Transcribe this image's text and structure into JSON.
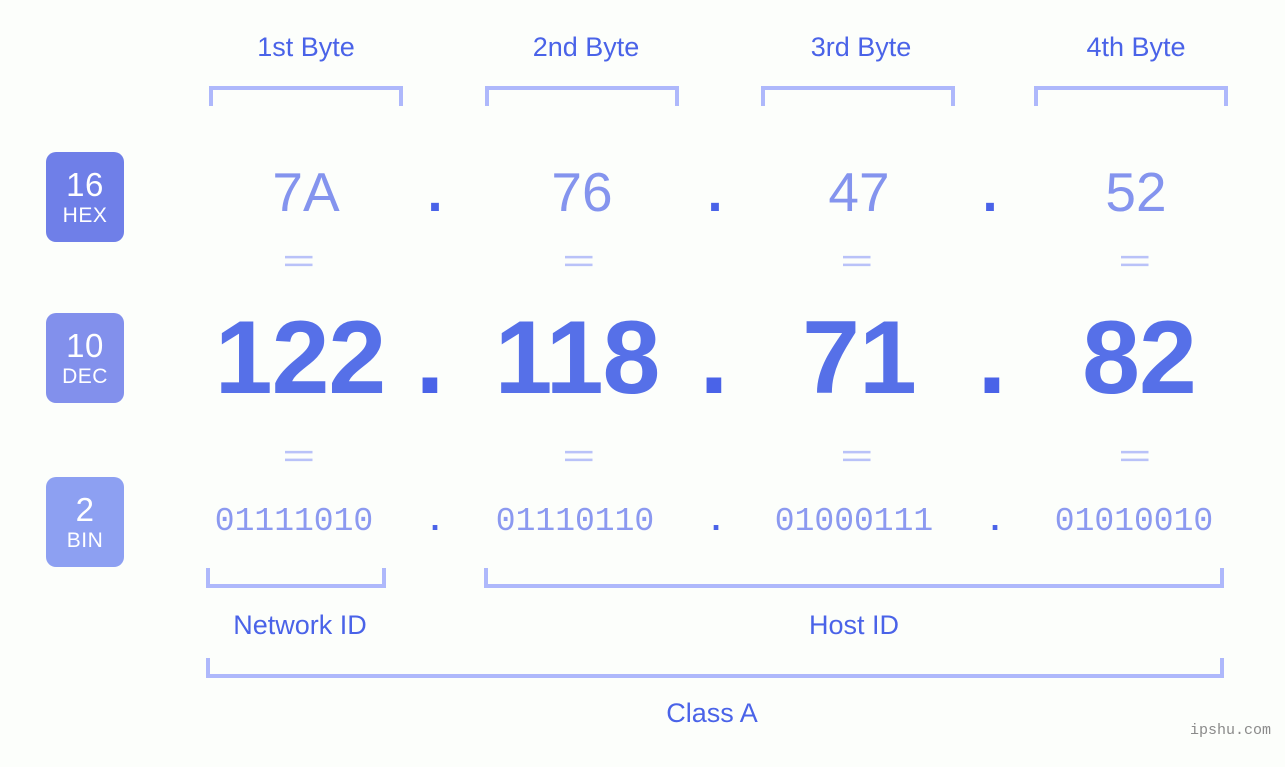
{
  "meta": {
    "background_color": "#fcfefb",
    "accent_color": "#4a63e8",
    "bracket_color": "#aeb8fb",
    "watermark": "ipshu.com"
  },
  "byte_headers": [
    {
      "label": "1st Byte"
    },
    {
      "label": "2nd Byte"
    },
    {
      "label": "3rd Byte"
    },
    {
      "label": "4th Byte"
    }
  ],
  "rows": [
    {
      "id": "hex",
      "badge": {
        "num": "16",
        "abbr": "HEX",
        "color": "#6f7fe8"
      },
      "values": [
        "7A",
        "76",
        "47",
        "52"
      ],
      "separator": "."
    },
    {
      "id": "dec",
      "badge": {
        "num": "10",
        "abbr": "DEC",
        "color": "#8290ec"
      },
      "values": [
        "122",
        "118",
        "71",
        "82"
      ],
      "separator": "."
    },
    {
      "id": "bin",
      "badge": {
        "num": "2",
        "abbr": "BIN",
        "color": "#8da0f2"
      },
      "values": [
        "01111010",
        "01110110",
        "01000111",
        "01010010"
      ],
      "separator": "."
    }
  ],
  "equals_symbol": "||",
  "sections": [
    {
      "label": "Network ID"
    },
    {
      "label": "Host ID"
    }
  ],
  "class_label": "Class A",
  "chart_data": {
    "type": "table",
    "title": "IP address byte breakdown",
    "columns": [
      "1st Byte",
      "2nd Byte",
      "3rd Byte",
      "4th Byte"
    ],
    "rows": [
      {
        "base": "16",
        "name": "HEX",
        "values": [
          "7A",
          "76",
          "47",
          "52"
        ]
      },
      {
        "base": "10",
        "name": "DEC",
        "values": [
          "122",
          "118",
          "71",
          "82"
        ]
      },
      {
        "base": "2",
        "name": "BIN",
        "values": [
          "01111010",
          "01110110",
          "01000111",
          "01010010"
        ]
      }
    ],
    "network_id_bytes": 1,
    "host_id_bytes": 3,
    "ip_class": "Class A"
  }
}
